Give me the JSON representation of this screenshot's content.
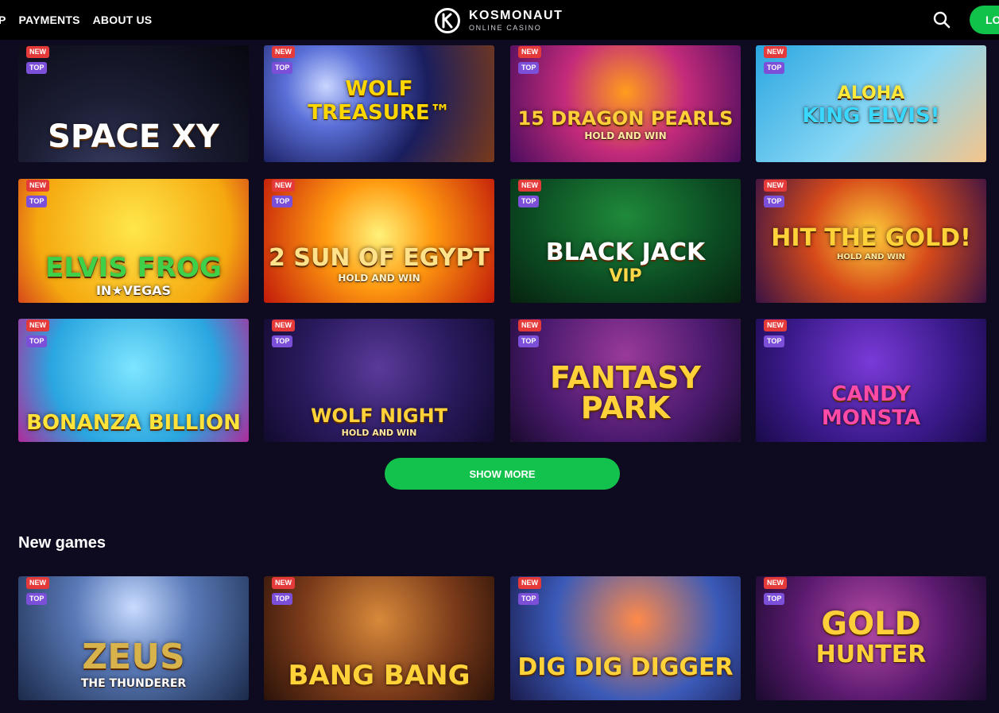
{
  "nav": {
    "partial": "P",
    "payments": "PAYMENTS",
    "about": "ABOUT US"
  },
  "logo": {
    "name": "KOSMONAUT",
    "sub": "ONLINE CASINO"
  },
  "header": {
    "login_label": "LO"
  },
  "badges": {
    "new": "NEW",
    "top": "TOP"
  },
  "games": [
    {
      "id": "space-xy",
      "line1": "SPACE XY",
      "line2": ""
    },
    {
      "id": "wolf-treasure",
      "line1": "WOLF",
      "line2": "TREASURE™"
    },
    {
      "id": "15-dragon-pearls",
      "line1": "15 DRAGON PEARLS",
      "line2": "HOLD AND WIN"
    },
    {
      "id": "aloha-king-elvis",
      "line1": "Aloha",
      "line2": "KING ELVIS!"
    },
    {
      "id": "elvis-frog",
      "line1": "ELVIS FROG",
      "line2": "IN★VEGAS"
    },
    {
      "id": "sun-of-egypt-2",
      "line1": "2 SUN OF EGYPT",
      "line2": "HOLD AND WIN"
    },
    {
      "id": "blackjack-vip",
      "line1": "BLACK JACK",
      "line2": "VIP"
    },
    {
      "id": "hit-the-gold",
      "line1": "HIT THE GOLD!",
      "line2": "HOLD AND WIN"
    },
    {
      "id": "bonanza-billion",
      "line1": "BONANZA BILLION",
      "line2": ""
    },
    {
      "id": "wolf-night",
      "line1": "WOLF NIGHT",
      "line2": "HOLD AND WIN"
    },
    {
      "id": "fantasy-park",
      "line1": "FANTASY PARK",
      "line2": ""
    },
    {
      "id": "candy-monsta",
      "line1": "Candy",
      "line2": "Monsta"
    }
  ],
  "show_more_label": "SHOW MORE",
  "new_games": {
    "title": "New games",
    "items": [
      {
        "id": "zeus-the-thunderer",
        "line1": "ZEUS",
        "line2": "THE THUNDERER"
      },
      {
        "id": "bang-bang",
        "line1": "BANG BANG",
        "line2": ""
      },
      {
        "id": "dig-dig-digger",
        "line1": "DIG DIG DIGGER",
        "line2": ""
      },
      {
        "id": "gold-hunter",
        "line1": "GOLD",
        "line2": "HUNTER"
      }
    ]
  },
  "colors": {
    "background": "#0e0a1f",
    "header": "#000000",
    "accent_green": "#13c24c",
    "badge_new": "#e53a3a",
    "badge_top": "#7c4fd8"
  }
}
